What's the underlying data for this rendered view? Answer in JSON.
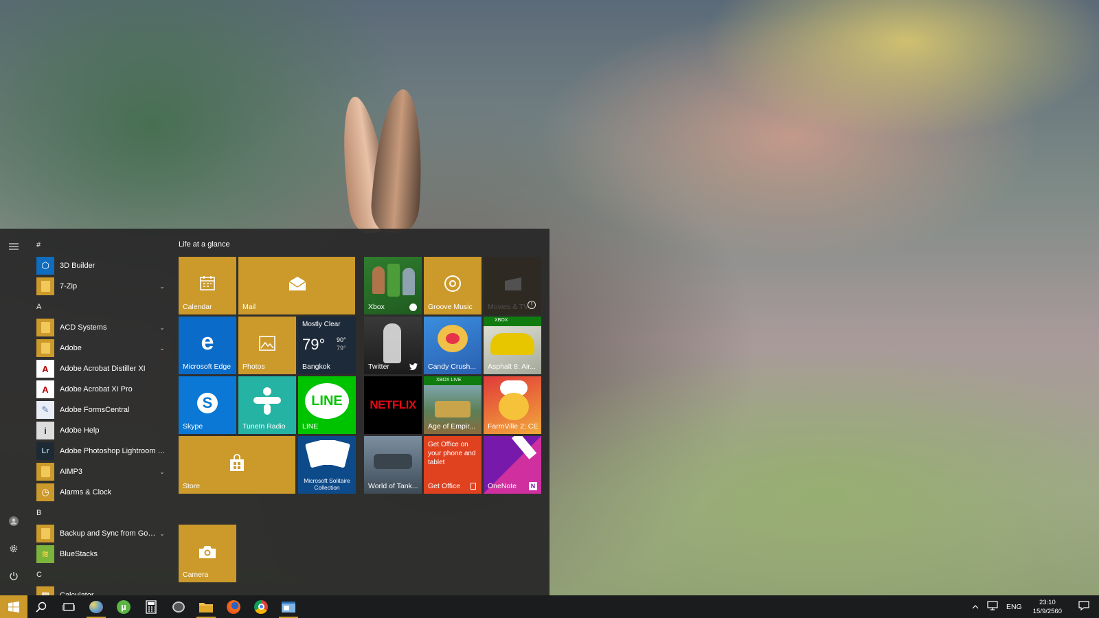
{
  "start_menu": {
    "group_title": "Life at a glance",
    "apps": [
      {
        "type": "letter",
        "text": "#"
      },
      {
        "type": "app",
        "label": "3D Builder",
        "icon": "3d-builder-icon",
        "expandable": false
      },
      {
        "type": "app",
        "label": "7-Zip",
        "icon": "folder-icon",
        "expandable": true
      },
      {
        "type": "letter",
        "text": "A"
      },
      {
        "type": "app",
        "label": "ACD Systems",
        "icon": "folder-icon",
        "expandable": true
      },
      {
        "type": "app",
        "label": "Adobe",
        "icon": "folder-icon",
        "expandable": true
      },
      {
        "type": "app",
        "label": "Adobe Acrobat Distiller XI",
        "icon": "acrobat-icon",
        "expandable": false
      },
      {
        "type": "app",
        "label": "Adobe Acrobat XI Pro",
        "icon": "acrobat-icon",
        "expandable": false
      },
      {
        "type": "app",
        "label": "Adobe FormsCentral",
        "icon": "forms-icon",
        "expandable": false
      },
      {
        "type": "app",
        "label": "Adobe Help",
        "icon": "info-icon",
        "expandable": false
      },
      {
        "type": "app",
        "label": "Adobe Photoshop Lightroom 5.7...",
        "icon": "lightroom-icon",
        "expandable": false
      },
      {
        "type": "app",
        "label": "AIMP3",
        "icon": "folder-icon",
        "expandable": true
      },
      {
        "type": "app",
        "label": "Alarms & Clock",
        "icon": "alarm-icon",
        "expandable": false
      },
      {
        "type": "letter",
        "text": "B"
      },
      {
        "type": "app",
        "label": "Backup and Sync from Google",
        "icon": "folder-icon",
        "expandable": true
      },
      {
        "type": "app",
        "label": "BlueStacks",
        "icon": "bluestacks-icon",
        "expandable": false
      },
      {
        "type": "letter",
        "text": "C"
      },
      {
        "type": "app",
        "label": "Calculator",
        "icon": "calculator-icon",
        "expandable": false
      }
    ],
    "tiles": {
      "calendar": "Calendar",
      "mail": "Mail",
      "xbox": "Xbox",
      "groove": "Groove Music",
      "movies": "Movies & TV",
      "edge": "Microsoft Edge",
      "photos": "Photos",
      "weather": {
        "condition": "Mostly Clear",
        "temp": "79°",
        "high": "90°",
        "low": "79°",
        "city": "Bangkok"
      },
      "twitter": "Twitter",
      "candy": "Candy Crush...",
      "asphalt": "Asphalt 8: Air...",
      "asphalt_badge": "XBOX",
      "skype": "Skype",
      "tunein": "TuneIn Radio",
      "line": "LINE",
      "line_logo": "LINE",
      "netflix_logo": "NETFLIX",
      "aoe": "Age of Empir...",
      "aoe_badge": "XBOX LIVE",
      "farmville": "FarmVille 2: CE",
      "store": "Store",
      "solitaire": "Microsoft Solitaire Collection",
      "wot": "World of Tank...",
      "office_text": "Get Office on your phone and tablet",
      "office": "Get Office",
      "onenote": "OneNote",
      "camera": "Camera"
    }
  },
  "taskbar": {
    "language": "ENG",
    "time": "23:10",
    "date": "15/9/2560"
  },
  "colors": {
    "accent": "#cc9a2b",
    "taskbar": "#1a1c1e",
    "start_bg": "#282828"
  }
}
